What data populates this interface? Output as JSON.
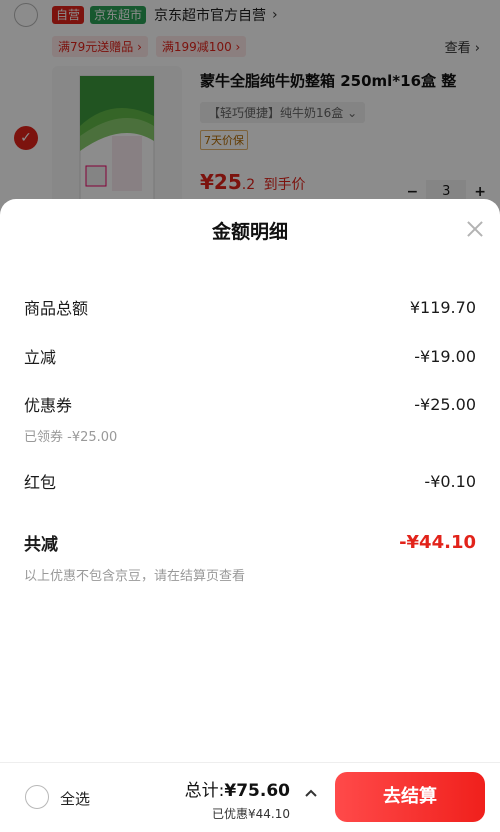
{
  "cart": {
    "self_operated_badge": "自营",
    "supermarket_badge": "京东超市",
    "shop_name": "京东超市官方自营",
    "promos": [
      "满79元送赠品",
      "满199减100"
    ],
    "view_link": "查看",
    "product": {
      "title": "蒙牛全脂纯牛奶整箱 250ml*16盒 整",
      "spec": "【轻巧便捷】纯牛奶16盒",
      "guarantee": "7天价保",
      "price_int": "¥25",
      "price_dec": ".2",
      "price_suffix": "到手价",
      "quantity": "3"
    }
  },
  "sheet": {
    "title": "金额明细",
    "rows": {
      "goods_total": {
        "label": "商品总额",
        "value": "¥119.70"
      },
      "instant_discount": {
        "label": "立减",
        "value": "-¥19.00"
      },
      "coupon": {
        "label": "优惠券",
        "value": "-¥25.00",
        "sub": "已领券 -¥25.00"
      },
      "red_packet": {
        "label": "红包",
        "value": "-¥0.10"
      },
      "total_reduce": {
        "label": "共减",
        "value": "-¥44.10"
      }
    },
    "note": "以上优惠不包含京豆，请在结算页查看"
  },
  "bottom": {
    "select_all": "全选",
    "total_label": "总计:",
    "total_value": "¥75.60",
    "saved_label": "已优惠",
    "saved_value": "¥44.10",
    "checkout": "去结算"
  },
  "colors": {
    "accent": "#e2231a",
    "green_badge": "#2aa157"
  }
}
